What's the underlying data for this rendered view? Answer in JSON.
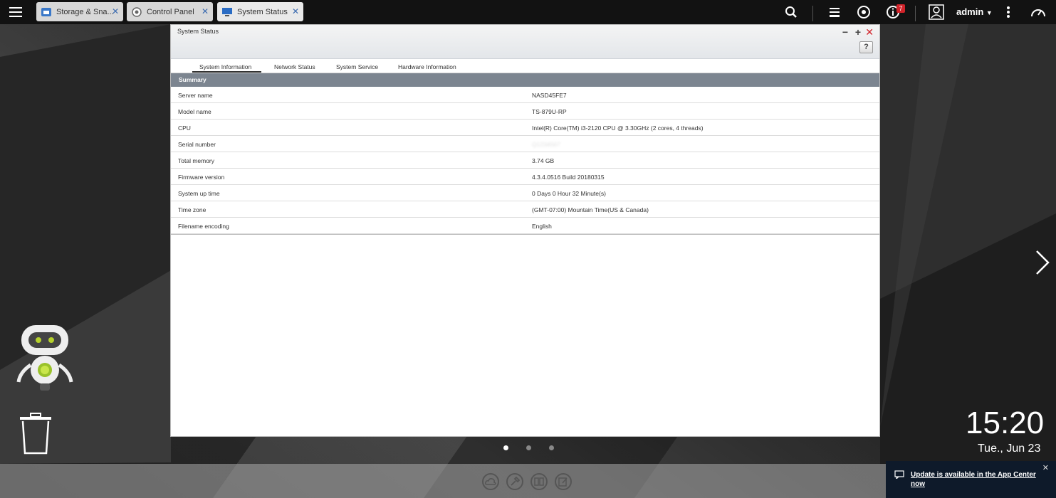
{
  "topbar": {
    "tabs": [
      {
        "label": "Storage & Sna..."
      },
      {
        "label": "Control Panel"
      },
      {
        "label": "System Status"
      }
    ],
    "notification_count": "7",
    "user": "admin"
  },
  "window": {
    "title": "System Status",
    "help_label": "?",
    "tabs": [
      {
        "label": "System Information"
      },
      {
        "label": "Network Status"
      },
      {
        "label": "System Service"
      },
      {
        "label": "Hardware Information"
      }
    ],
    "section_title": "Summary",
    "rows": [
      {
        "key": "Server name",
        "value": "NASD45FE7"
      },
      {
        "key": "Model name",
        "value": "TS-879U-RP"
      },
      {
        "key": "CPU",
        "value": "Intel(R) Core(TM) i3-2120 CPU @ 3.30GHz (2 cores, 4 threads)"
      },
      {
        "key": "Serial number",
        "value": "Q1234567"
      },
      {
        "key": "Total memory",
        "value": "3.74 GB"
      },
      {
        "key": "Firmware version",
        "value": "4.3.4.0516 Build 20180315"
      },
      {
        "key": "System up time",
        "value": "0 Days 0 Hour 32 Minute(s)"
      },
      {
        "key": "Time zone",
        "value": "(GMT-07:00) Mountain Time(US & Canada)"
      },
      {
        "key": "Filename encoding",
        "value": "English"
      }
    ]
  },
  "desktop": {
    "time": "15:20",
    "date": "Tue., Jun 23"
  },
  "notification": {
    "message": "Update is available in the App Center now"
  },
  "colors": {
    "topbar": "#121212",
    "section_head": "#7c8590",
    "badge": "#d2232a",
    "close": "#d2232a"
  }
}
